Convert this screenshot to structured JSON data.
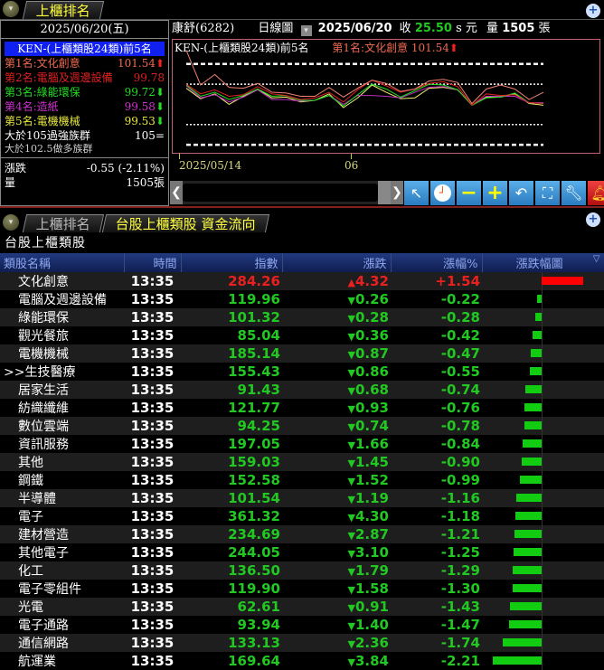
{
  "top_tab": {
    "label": "上櫃排名"
  },
  "left": {
    "date": "2025/06/20(五)",
    "header": "KEN-(上櫃類股24類)前5名",
    "ranks": [
      {
        "label": "第1名:文化創意",
        "value": "101.54",
        "arrow": "up",
        "color": "#f06a50"
      },
      {
        "label": "第2名:電腦及週邊設備",
        "value": "99.78",
        "arrow": "",
        "color": "#e02020"
      },
      {
        "label": "第3名:綠能環保",
        "value": "99.72",
        "arrow": "down",
        "color": "#22dd22"
      },
      {
        "label": "第4名:造紙",
        "value": "99.58",
        "arrow": "down",
        "color": "#d030d0"
      },
      {
        "label": "第5名:電機機械",
        "value": "99.53",
        "arrow": "down",
        "color": "#e8e840"
      }
    ],
    "strong": {
      "label": "大於105過強族群",
      "value": "105="
    },
    "bull": {
      "label": "大於102.5做多族群"
    },
    "change_label": "漲跌",
    "change_value": "-0.55 (-2.11%)",
    "volume_label": "量",
    "volume_value": "1505張"
  },
  "header": {
    "stock": "康舒(6282)",
    "period": "日線圖",
    "date": "2025/06/20",
    "close_label": "收",
    "close": "25.50",
    "close_suffix": "s 元",
    "vol_label": "量",
    "vol": "1505",
    "vol_unit": "張"
  },
  "chart_data": {
    "type": "line",
    "title": "KEN-(上櫃類股24類)前5名",
    "legend_top": "第1名:文化創意 101.54",
    "x_ticks": [
      "2025/05/14",
      "06"
    ],
    "reference_lines": [
      105,
      102.5,
      97.5,
      95
    ],
    "ylim": [
      94,
      108
    ],
    "series": [
      {
        "name": "文化創意",
        "color": "#f08070",
        "values": [
          106.7,
          102.4,
          103.7,
          102.1,
          102.0,
          102.6,
          101.5,
          101.4,
          101.0,
          101.0,
          102.1,
          100.9,
          102.0,
          103.0,
          102.6,
          101.6,
          101.9,
          102.9,
          103.1,
          102.7,
          100.1,
          101.9,
          102.4,
          101.9,
          100.6,
          101.5
        ]
      },
      {
        "name": "電腦及週邊設備",
        "color": "#e02020",
        "values": [
          102.5,
          101.3,
          101.8,
          101.0,
          101.2,
          102.2,
          101.3,
          101.1,
          100.6,
          100.8,
          101.5,
          100.3,
          101.8,
          103.0,
          102.3,
          101.5,
          101.9,
          102.6,
          102.8,
          102.2,
          99.9,
          101.3,
          101.1,
          101.2,
          100.2,
          100.1
        ]
      },
      {
        "name": "綠能環保",
        "color": "#22dd22",
        "values": [
          102.4,
          101.0,
          101.5,
          100.6,
          101.1,
          101.9,
          101.0,
          101.1,
          100.5,
          100.5,
          101.1,
          99.8,
          101.2,
          102.5,
          101.9,
          100.9,
          101.7,
          102.5,
          102.4,
          101.8,
          99.9,
          100.8,
          100.9,
          101.4,
          100.2,
          100.1
        ]
      },
      {
        "name": "造紙",
        "color": "#c030c0",
        "values": [
          102.3,
          100.8,
          101.2,
          100.3,
          100.9,
          101.8,
          100.6,
          100.6,
          100.4,
          100.5,
          101.1,
          100.0,
          101.1,
          101.1,
          101.0,
          100.8,
          101.5,
          102.1,
          102.2,
          101.8,
          99.9,
          101.0,
          101.0,
          101.0,
          100.2,
          100.2
        ]
      },
      {
        "name": "電機機械",
        "color": "#f0f070",
        "values": [
          102.0,
          100.7,
          101.3,
          100.0,
          101.0,
          101.9,
          100.8,
          100.9,
          100.3,
          100.5,
          101.3,
          99.6,
          100.8,
          102.4,
          101.5,
          100.7,
          100.8,
          102.0,
          102.1,
          101.8,
          99.9,
          100.9,
          100.9,
          101.3,
          100.1,
          99.9
        ]
      }
    ]
  },
  "bottom_tabs": [
    {
      "label": "上櫃排名"
    },
    {
      "label": "台股上櫃類股 資金流向"
    }
  ],
  "section_title": "台股上櫃類股",
  "table": {
    "columns": [
      "類股名稱",
      "時間",
      "指數",
      "漲跌",
      "漲幅%",
      "漲跌幅圖"
    ],
    "rows": [
      {
        "name": "文化創意",
        "time": "13:35",
        "index": "284.26",
        "change": "4.32",
        "pct": "+1.54",
        "pct_value": 1.54
      },
      {
        "name": "電腦及週邊設備",
        "time": "13:35",
        "index": "119.96",
        "change": "0.26",
        "pct": "-0.22",
        "pct_value": -0.22
      },
      {
        "name": "綠能環保",
        "time": "13:35",
        "index": "101.32",
        "change": "0.28",
        "pct": "-0.28",
        "pct_value": -0.28
      },
      {
        "name": "觀光餐旅",
        "time": "13:35",
        "index": "85.04",
        "change": "0.36",
        "pct": "-0.42",
        "pct_value": -0.42
      },
      {
        "name": "電機機械",
        "time": "13:35",
        "index": "185.14",
        "change": "0.87",
        "pct": "-0.47",
        "pct_value": -0.47
      },
      {
        "name": ">>生技醫療",
        "time": "13:35",
        "index": "155.43",
        "change": "0.86",
        "pct": "-0.55",
        "pct_value": -0.55
      },
      {
        "name": "居家生活",
        "time": "13:35",
        "index": "91.43",
        "change": "0.68",
        "pct": "-0.74",
        "pct_value": -0.74
      },
      {
        "name": "紡織纖維",
        "time": "13:35",
        "index": "121.77",
        "change": "0.93",
        "pct": "-0.76",
        "pct_value": -0.76
      },
      {
        "name": "數位雲端",
        "time": "13:35",
        "index": "94.25",
        "change": "0.74",
        "pct": "-0.78",
        "pct_value": -0.78
      },
      {
        "name": "資訊服務",
        "time": "13:35",
        "index": "197.05",
        "change": "1.66",
        "pct": "-0.84",
        "pct_value": -0.84
      },
      {
        "name": "其他",
        "time": "13:35",
        "index": "159.03",
        "change": "1.45",
        "pct": "-0.90",
        "pct_value": -0.9
      },
      {
        "name": "鋼鐵",
        "time": "13:35",
        "index": "152.58",
        "change": "1.52",
        "pct": "-0.99",
        "pct_value": -0.99
      },
      {
        "name": "半導體",
        "time": "13:35",
        "index": "101.54",
        "change": "1.19",
        "pct": "-1.16",
        "pct_value": -1.16
      },
      {
        "name": "電子",
        "time": "13:35",
        "index": "361.32",
        "change": "4.30",
        "pct": "-1.18",
        "pct_value": -1.18
      },
      {
        "name": "建材營造",
        "time": "13:35",
        "index": "234.69",
        "change": "2.87",
        "pct": "-1.21",
        "pct_value": -1.21
      },
      {
        "name": "其他電子",
        "time": "13:35",
        "index": "244.05",
        "change": "3.10",
        "pct": "-1.25",
        "pct_value": -1.25
      },
      {
        "name": "化工",
        "time": "13:35",
        "index": "136.50",
        "change": "1.79",
        "pct": "-1.29",
        "pct_value": -1.29
      },
      {
        "name": "電子零組件",
        "time": "13:35",
        "index": "119.90",
        "change": "1.58",
        "pct": "-1.30",
        "pct_value": -1.3
      },
      {
        "name": "光電",
        "time": "13:35",
        "index": "62.61",
        "change": "0.91",
        "pct": "-1.43",
        "pct_value": -1.43
      },
      {
        "name": "電子通路",
        "time": "13:35",
        "index": "93.94",
        "change": "1.40",
        "pct": "-1.47",
        "pct_value": -1.47
      },
      {
        "name": "通信網路",
        "time": "13:35",
        "index": "133.13",
        "change": "2.36",
        "pct": "-1.74",
        "pct_value": -1.74
      },
      {
        "name": "航運業",
        "time": "13:35",
        "index": "169.64",
        "change": "3.84",
        "pct": "-2.21",
        "pct_value": -2.21
      }
    ]
  },
  "colors": {
    "up": "#e82020",
    "down": "#22c822",
    "header_text": "#8fa8f0",
    "tab_active": "#ffff40"
  }
}
